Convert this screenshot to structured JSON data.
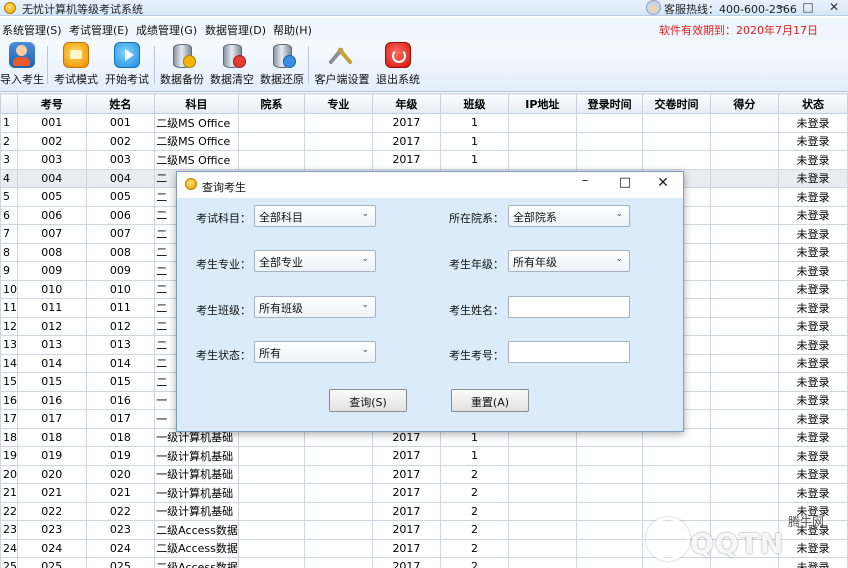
{
  "app": {
    "title": "无忧计算机等级考试系统",
    "hotline": "客服热线：400-600-2366",
    "expiry": "软件有效期到：2020年7月17日"
  },
  "menu": [
    "系统管理(S)",
    "考试管理(E)",
    "成绩管理(G)",
    "数据管理(D)",
    "帮助(H)"
  ],
  "toolbar": {
    "import": "导入考生",
    "mode": "考试模式",
    "start": "开始考试",
    "backup": "数据备份",
    "clear": "数据清空",
    "restore": "数据还原",
    "client": "客户端设置",
    "exit": "退出系统"
  },
  "table": {
    "headers": [
      "考号",
      "姓名",
      "科目",
      "院系",
      "专业",
      "年级",
      "班级",
      "IP地址",
      "登录时间",
      "交卷时间",
      "得分",
      "状态"
    ],
    "rows": [
      [
        "001",
        "001",
        "二级MS Office",
        "",
        "",
        "2017",
        "1",
        "",
        "",
        "",
        "",
        "未登录"
      ],
      [
        "002",
        "002",
        "二级MS Office",
        "",
        "",
        "2017",
        "1",
        "",
        "",
        "",
        "",
        "未登录"
      ],
      [
        "003",
        "003",
        "二级MS Office",
        "",
        "",
        "2017",
        "1",
        "",
        "",
        "",
        "",
        "未登录"
      ],
      [
        "004",
        "004",
        "二",
        "",
        "",
        "",
        "",
        "",
        "",
        "",
        "",
        "未登录"
      ],
      [
        "005",
        "005",
        "二",
        "",
        "",
        "",
        "",
        "",
        "",
        "",
        "",
        "未登录"
      ],
      [
        "006",
        "006",
        "二",
        "",
        "",
        "",
        "",
        "",
        "",
        "",
        "",
        "未登录"
      ],
      [
        "007",
        "007",
        "二",
        "",
        "",
        "",
        "",
        "",
        "",
        "",
        "",
        "未登录"
      ],
      [
        "008",
        "008",
        "二",
        "",
        "",
        "",
        "",
        "",
        "",
        "",
        "",
        "未登录"
      ],
      [
        "009",
        "009",
        "二",
        "",
        "",
        "",
        "",
        "",
        "",
        "",
        "",
        "未登录"
      ],
      [
        "010",
        "010",
        "二",
        "",
        "",
        "",
        "",
        "",
        "",
        "",
        "",
        "未登录"
      ],
      [
        "011",
        "011",
        "二",
        "",
        "",
        "",
        "",
        "",
        "",
        "",
        "",
        "未登录"
      ],
      [
        "012",
        "012",
        "二",
        "",
        "",
        "",
        "",
        "",
        "",
        "",
        "",
        "未登录"
      ],
      [
        "013",
        "013",
        "二",
        "",
        "",
        "",
        "",
        "",
        "",
        "",
        "",
        "未登录"
      ],
      [
        "014",
        "014",
        "二",
        "",
        "",
        "",
        "",
        "",
        "",
        "",
        "",
        "未登录"
      ],
      [
        "015",
        "015",
        "二",
        "",
        "",
        "",
        "",
        "",
        "",
        "",
        "",
        "未登录"
      ],
      [
        "016",
        "016",
        "一",
        "",
        "",
        "",
        "",
        "",
        "",
        "",
        "",
        "未登录"
      ],
      [
        "017",
        "017",
        "一",
        "",
        "",
        "",
        "",
        "",
        "",
        "",
        "",
        "未登录"
      ],
      [
        "018",
        "018",
        "一级计算机基础",
        "",
        "",
        "2017",
        "1",
        "",
        "",
        "",
        "",
        "未登录"
      ],
      [
        "019",
        "019",
        "一级计算机基础",
        "",
        "",
        "2017",
        "1",
        "",
        "",
        "",
        "",
        "未登录"
      ],
      [
        "020",
        "020",
        "一级计算机基础",
        "",
        "",
        "2017",
        "2",
        "",
        "",
        "",
        "",
        "未登录"
      ],
      [
        "021",
        "021",
        "一级计算机基础",
        "",
        "",
        "2017",
        "2",
        "",
        "",
        "",
        "",
        "未登录"
      ],
      [
        "022",
        "022",
        "一级计算机基础",
        "",
        "",
        "2017",
        "2",
        "",
        "",
        "",
        "",
        "未登录"
      ],
      [
        "023",
        "023",
        "二级Access数据",
        "",
        "",
        "2017",
        "2",
        "",
        "",
        "",
        "",
        "未登录"
      ],
      [
        "024",
        "024",
        "二级Access数据",
        "",
        "",
        "2017",
        "2",
        "",
        "",
        "",
        "",
        "未登录"
      ],
      [
        "025",
        "025",
        "二级Access数据",
        "",
        "",
        "2017",
        "2",
        "",
        "",
        "",
        "",
        "未登录"
      ]
    ]
  },
  "dialog": {
    "title": "查询考生",
    "subject_label": "考试科目：",
    "subject_value": "全部科目",
    "department_label": "所在院系：",
    "department_value": "全部院系",
    "major_label": "考生专业：",
    "major_value": "全部专业",
    "grade_label": "考生年级：",
    "grade_value": "所有年级",
    "class_label": "考生班级：",
    "class_value": "所有班级",
    "name_label": "考生姓名：",
    "name_value": "",
    "status_label": "考生状态：",
    "status_value": "所有",
    "id_label": "考生考号：",
    "id_value": "",
    "query_button": "查询(S)",
    "reset_button": "重置(A)"
  },
  "watermark": {
    "text": "QQTN",
    "site": "腾牛网"
  },
  "colors": {
    "expiry": "#e0201b",
    "dialog_bg": "#dcebf9"
  }
}
